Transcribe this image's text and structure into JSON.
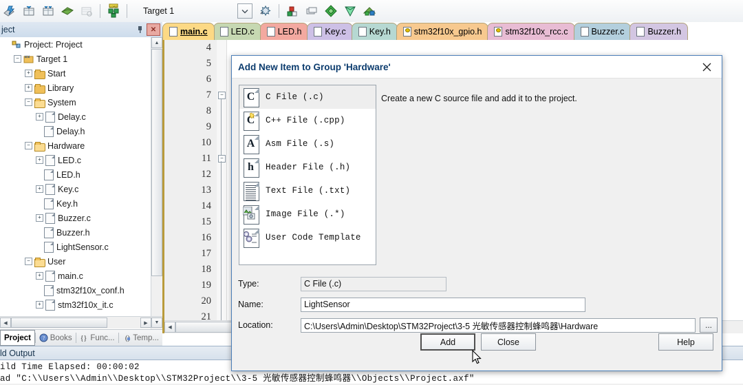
{
  "toolbar": {
    "icons": [
      "build-icon",
      "rebuild-icon",
      "batch-build-icon",
      "translate-icon",
      "stop-build-icon",
      "load-icon"
    ],
    "target_value": "Target 1",
    "target_dropdown_icon": "chevron-down-icon",
    "right_icons": [
      "target-options-icon",
      "manage-components-icon",
      "configure-diamond-icon",
      "pack-installer-icon",
      "multi-project-icon"
    ]
  },
  "project_panel": {
    "title": "ject",
    "pin_icon": "pin-icon",
    "close_icon": "close-icon",
    "tree": [
      {
        "label": "Project: Project",
        "depth": 0,
        "expander": "",
        "icon": "project-icon"
      },
      {
        "label": "Target 1",
        "depth": 1,
        "expander": "-",
        "icon": "target-icon"
      },
      {
        "label": "Start",
        "depth": 2,
        "expander": "+",
        "icon": "folder-closed"
      },
      {
        "label": "Library",
        "depth": 2,
        "expander": "+",
        "icon": "folder-closed"
      },
      {
        "label": "System",
        "depth": 2,
        "expander": "-",
        "icon": "folder-open"
      },
      {
        "label": "Delay.c",
        "depth": 3,
        "expander": "+",
        "icon": "file"
      },
      {
        "label": "Delay.h",
        "depth": 3,
        "expander": "",
        "icon": "file"
      },
      {
        "label": "Hardware",
        "depth": 2,
        "expander": "-",
        "icon": "folder-open"
      },
      {
        "label": "LED.c",
        "depth": 3,
        "expander": "+",
        "icon": "file"
      },
      {
        "label": "LED.h",
        "depth": 3,
        "expander": "",
        "icon": "file"
      },
      {
        "label": "Key.c",
        "depth": 3,
        "expander": "+",
        "icon": "file"
      },
      {
        "label": "Key.h",
        "depth": 3,
        "expander": "",
        "icon": "file"
      },
      {
        "label": "Buzzer.c",
        "depth": 3,
        "expander": "+",
        "icon": "file"
      },
      {
        "label": "Buzzer.h",
        "depth": 3,
        "expander": "",
        "icon": "file"
      },
      {
        "label": "LightSensor.c",
        "depth": 3,
        "expander": "",
        "icon": "file"
      },
      {
        "label": "User",
        "depth": 2,
        "expander": "-",
        "icon": "folder-open"
      },
      {
        "label": "main.c",
        "depth": 3,
        "expander": "+",
        "icon": "file"
      },
      {
        "label": "stm32f10x_conf.h",
        "depth": 3,
        "expander": "",
        "icon": "file"
      },
      {
        "label": "stm32f10x_it.c",
        "depth": 3,
        "expander": "+",
        "icon": "file"
      }
    ],
    "tabs": [
      {
        "label": "Project",
        "icon": "project-tab-icon",
        "active": true
      },
      {
        "label": "Books",
        "icon": "books-icon",
        "active": false
      },
      {
        "label": "Func...",
        "icon": "functions-icon",
        "active": false
      },
      {
        "label": "Temp...",
        "icon": "templates-icon",
        "active": false
      }
    ]
  },
  "editor": {
    "tabs": [
      {
        "label": "main.c",
        "color": "#fcd985",
        "active": true,
        "icon": "file-icon"
      },
      {
        "label": "LED.c",
        "color": "#c6d8b2",
        "active": false,
        "icon": "file-icon"
      },
      {
        "label": "LED.h",
        "color": "#f3a9a0",
        "active": false,
        "icon": "file-icon"
      },
      {
        "label": "Key.c",
        "color": "#cdc0e6",
        "active": false,
        "icon": "file-icon"
      },
      {
        "label": "Key.h",
        "color": "#b6d8d2",
        "active": false,
        "icon": "file-icon"
      },
      {
        "label": "stm32f10x_gpio.h",
        "color": "#f7c98f",
        "active": false,
        "icon": "file-readonly-icon"
      },
      {
        "label": "stm32f10x_rcc.c",
        "color": "#e8bcd4",
        "active": false,
        "icon": "file-readonly-icon"
      },
      {
        "label": "Buzzer.c",
        "color": "#b3cfdd",
        "active": false,
        "icon": "file-icon"
      },
      {
        "label": "Buzzer.h",
        "color": "#d3c6e2",
        "active": false,
        "icon": "file-icon"
      }
    ],
    "line_numbers": [
      "4",
      "5",
      "6",
      "7",
      "8",
      "9",
      "10",
      "11",
      "12",
      "13",
      "14",
      "15",
      "16",
      "17",
      "18",
      "19",
      "20",
      "21"
    ],
    "fold_markers": [
      "7",
      "11"
    ]
  },
  "build_output": {
    "title": "ld Output",
    "lines": [
      "ild Time Elapsed:  00:00:02",
      "ad \"C:\\\\Users\\\\Admin\\\\Desktop\\\\STM32Project\\\\3-5 光敏传感器控制蜂鸣器\\\\Objects\\\\Project.axf\""
    ]
  },
  "dialog": {
    "title": "Add New Item to Group 'Hardware'",
    "close_icon": "close-icon",
    "description": "Create a new C source file and add it to the project.",
    "file_types": [
      {
        "label": "C File (.c)",
        "icon": "c-file-icon",
        "glyph": "C",
        "selected": true
      },
      {
        "label": "C++ File (.cpp)",
        "icon": "cpp-file-icon",
        "glyph": "C",
        "selected": false
      },
      {
        "label": "Asm File (.s)",
        "icon": "asm-file-icon",
        "glyph": "A",
        "selected": false
      },
      {
        "label": "Header File (.h)",
        "icon": "header-file-icon",
        "glyph": "h",
        "selected": false
      },
      {
        "label": "Text File (.txt)",
        "icon": "text-file-icon",
        "glyph": "",
        "selected": false
      },
      {
        "label": "Image File (.*)",
        "icon": "image-file-icon",
        "glyph": "",
        "selected": false
      },
      {
        "label": "User Code Template",
        "icon": "user-code-template-icon",
        "glyph": "",
        "selected": false
      }
    ],
    "fields": {
      "type_label": "Type:",
      "type_value": "C File (.c)",
      "name_label": "Name:",
      "name_value": "LightSensor",
      "location_label": "Location:",
      "location_value": "C:\\Users\\Admin\\Desktop\\STM32Project\\3-5 光敏传感器控制蜂鸣器\\Hardware",
      "browse_label": "..."
    },
    "buttons": {
      "add": "Add",
      "close": "Close",
      "help": "Help"
    }
  }
}
